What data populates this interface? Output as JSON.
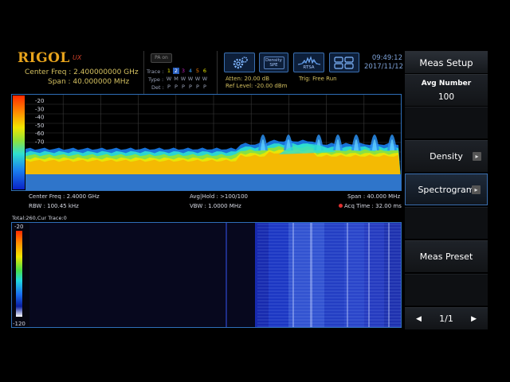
{
  "brand": {
    "logo": "RIGOL",
    "logo_sub": "UX",
    "pa_label": "PA on"
  },
  "header": {
    "center_freq": "Center Freq : 2.400000000 GHz",
    "span": "Span :   40.000000 MHz",
    "trace_label": "Trace :",
    "trace_numbers": [
      "1",
      "2",
      "3",
      "4",
      "5",
      "6"
    ],
    "type_label": "Type :",
    "type_values": [
      "W",
      "M",
      "W",
      "W",
      "W",
      "W"
    ],
    "det_label": "Det :",
    "det_values": [
      "P",
      "P",
      "P",
      "P",
      "P",
      "P"
    ],
    "atten": "Atten: 20.00 dB",
    "ref_level": "Ref Level: -20.00 dBm",
    "trig": "Trig: Free Run",
    "time": "09:49:12",
    "date": "2017/11/12"
  },
  "toolbar": {
    "density_spe_label": "Density SPE",
    "rtsa_label": "RTSA"
  },
  "spectrum": {
    "y_ticks": [
      "-20",
      "-30",
      "-40",
      "-50",
      "-60",
      "-70"
    ],
    "center_freq": "Center Freq : 2.4000 GHz",
    "rbw": "RBW : 100.45 kHz",
    "avg_hold": "Avg|Hold : >100/100",
    "vbw": "VBW : 1.0000 MHz",
    "span": "Span : 40.000 MHz",
    "acq_time": "Acq Time : 32.00 ms"
  },
  "spectrogram": {
    "total_label": "Total:260,Cur Trace:0",
    "scale_top": "-20",
    "scale_bottom": "-120"
  },
  "panel": {
    "title": "Meas Setup",
    "avg_number_label": "Avg Number",
    "avg_number_value": "100",
    "density_label": "Density",
    "spectrogram_label": "Spectrogram",
    "meas_preset_label": "Meas Preset",
    "page": "1/1"
  },
  "colors": {
    "accent": "#3a6fb0",
    "header_text": "#d4c060",
    "logo": "#e8a41c"
  }
}
